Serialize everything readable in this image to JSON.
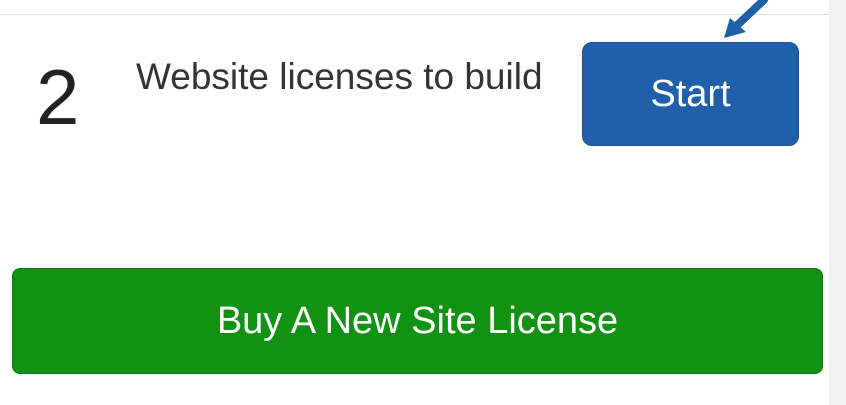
{
  "license_summary": {
    "count": "2",
    "description": "Website licenses to build"
  },
  "actions": {
    "start_label": "Start",
    "buy_label": "Buy A New Site License"
  },
  "icons": {
    "pointer": "pointer-arrow-icon"
  },
  "colors": {
    "start_button": "#2060aa",
    "buy_button": "#129212",
    "pointer_arrow": "#1f5fa8"
  }
}
